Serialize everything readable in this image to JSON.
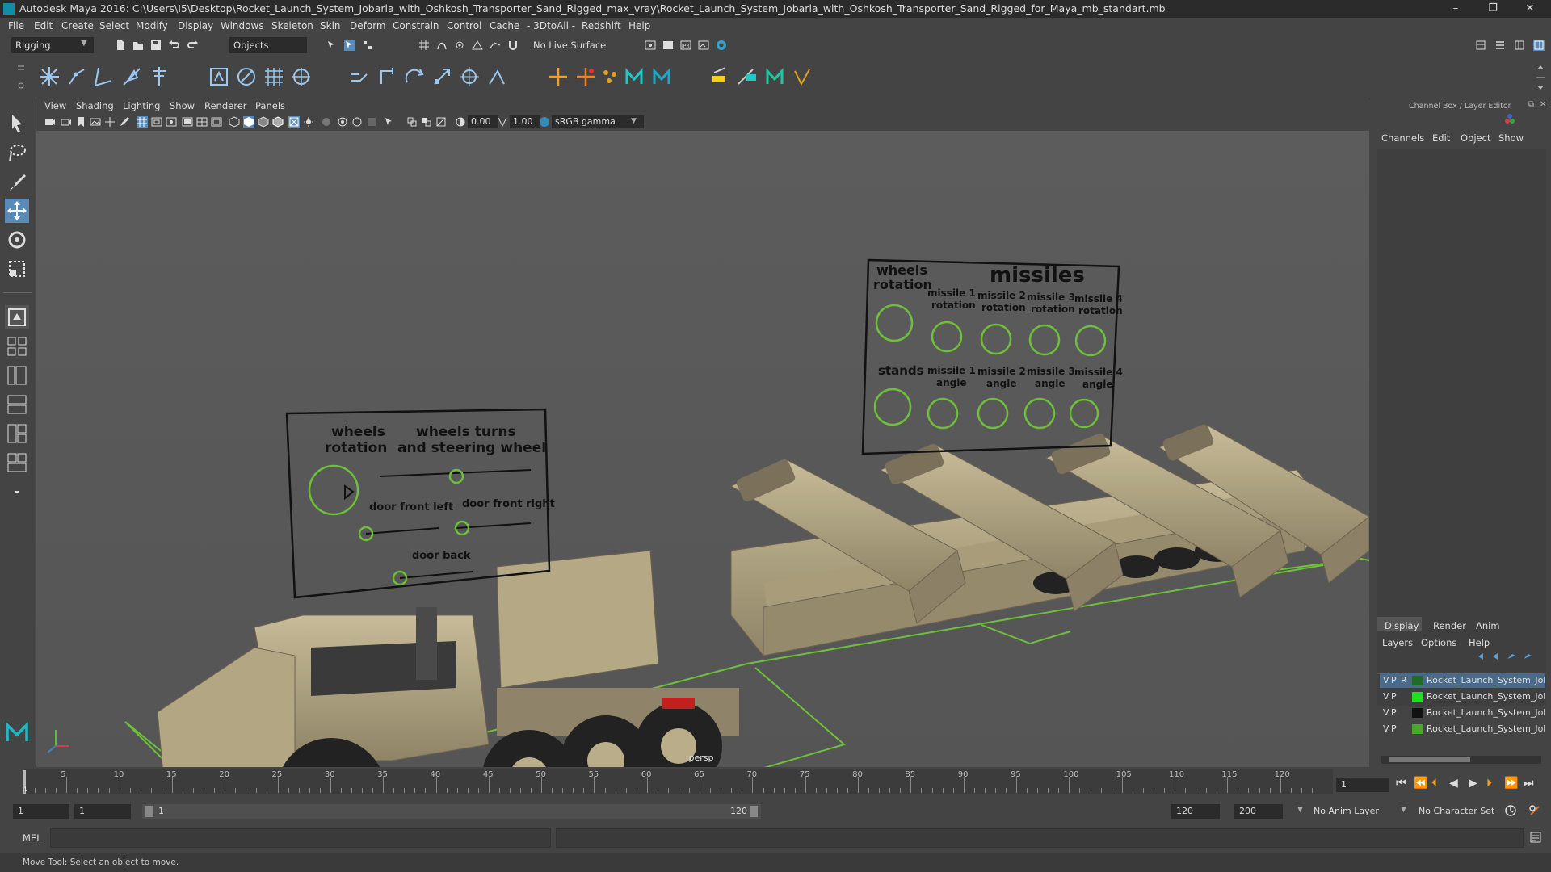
{
  "window": {
    "title": "Autodesk Maya 2016: C:\\Users\\I5\\Desktop\\Rocket_Launch_System_Jobaria_with_Oshkosh_Transporter_Sand_Rigged_max_vray\\Rocket_Launch_System_Jobaria_with_Oshkosh_Transporter_Sand_Rigged_for_Maya_mb_standart.mb",
    "minimize": "–",
    "maximize": "❐",
    "close": "✕"
  },
  "menus": [
    "File",
    "Edit",
    "Create",
    "Select",
    "Modify",
    "Display",
    "Windows",
    "Skeleton",
    "Skin",
    "Deform",
    "Constrain",
    "Control",
    "Cache",
    "- 3DtoAll -",
    "Redshift",
    "Help"
  ],
  "statusline": {
    "menuset": "Rigging",
    "select_mode": "Objects",
    "live_surface": "No Live Surface"
  },
  "viewport": {
    "menus": [
      "View",
      "Shading",
      "Lighting",
      "Show",
      "Renderer",
      "Panels"
    ],
    "near_value": "0.00",
    "far_value": "1.00",
    "color_space": "sRGB gamma",
    "camera_label": "persp"
  },
  "scene_labels": {
    "board1": {
      "wheels_rotation": [
        "wheels",
        "rotation"
      ],
      "wheels_turns": [
        "wheels turns",
        "and steering wheel"
      ],
      "door_front_left": "door front left",
      "door_front_right": "door front right",
      "door_back": "door back"
    },
    "board2": {
      "wheels_rotation": [
        "wheels",
        "rotation"
      ],
      "missiles": "missiles",
      "missile_rotations": [
        [
          "missile 1",
          "rotation"
        ],
        [
          "missile 2",
          "rotation"
        ],
        [
          "missile 3",
          "rotation"
        ],
        [
          "missile 4",
          "rotation"
        ]
      ],
      "stands": "stands",
      "missile_angles": [
        [
          "missile 1",
          "angle"
        ],
        [
          "missile 2",
          "angle"
        ],
        [
          "missile 3",
          "angle"
        ],
        [
          "missile 4",
          "angle"
        ]
      ]
    }
  },
  "right_panel": {
    "header": "Channel Box / Layer Editor",
    "channel_tabs": [
      "Channels",
      "Edit",
      "Object",
      "Show"
    ],
    "layer_tabs": [
      "Display",
      "Render",
      "Anim"
    ],
    "layer_menus": [
      "Layers",
      "Options",
      "Help"
    ],
    "layers": [
      {
        "v": "V",
        "p": "P",
        "r": "R",
        "color": "#1e6b2a",
        "name": "Rocket_Launch_System_Jobaria",
        "selected": true
      },
      {
        "v": "V",
        "p": "P",
        "r": "",
        "color": "#22dd22",
        "name": "Rocket_Launch_System_Jobaria",
        "selected": false
      },
      {
        "v": "V",
        "p": "P",
        "r": "",
        "color": "#111111",
        "name": "Rocket_Launch_System_Jobaria",
        "selected": false
      },
      {
        "v": "V",
        "p": "P",
        "r": "",
        "color": "#4aa82c",
        "name": "Rocket_Launch_System_Jobaria",
        "selected": false
      }
    ]
  },
  "timeline": {
    "ticks": [
      "5",
      "10",
      "15",
      "20",
      "25",
      "30",
      "35",
      "40",
      "45",
      "50",
      "55",
      "60",
      "65",
      "70",
      "75",
      "80",
      "85",
      "90",
      "95",
      "100",
      "105",
      "110",
      "115",
      "120"
    ],
    "current_frame": "1",
    "frame_field": "1"
  },
  "range": {
    "start": "1",
    "start_inner": "1",
    "slider_start": "1",
    "slider_end": "120",
    "end_inner": "120",
    "end": "200",
    "anim_layer": "No Anim Layer",
    "character_set": "No Character Set"
  },
  "cmdline": {
    "label": "MEL"
  },
  "helpline": {
    "text": "Move Tool: Select an object to move."
  },
  "colors": {
    "accent": "#5aa0d8",
    "ring": "#6ec03a",
    "sand": "#b8aa85"
  }
}
